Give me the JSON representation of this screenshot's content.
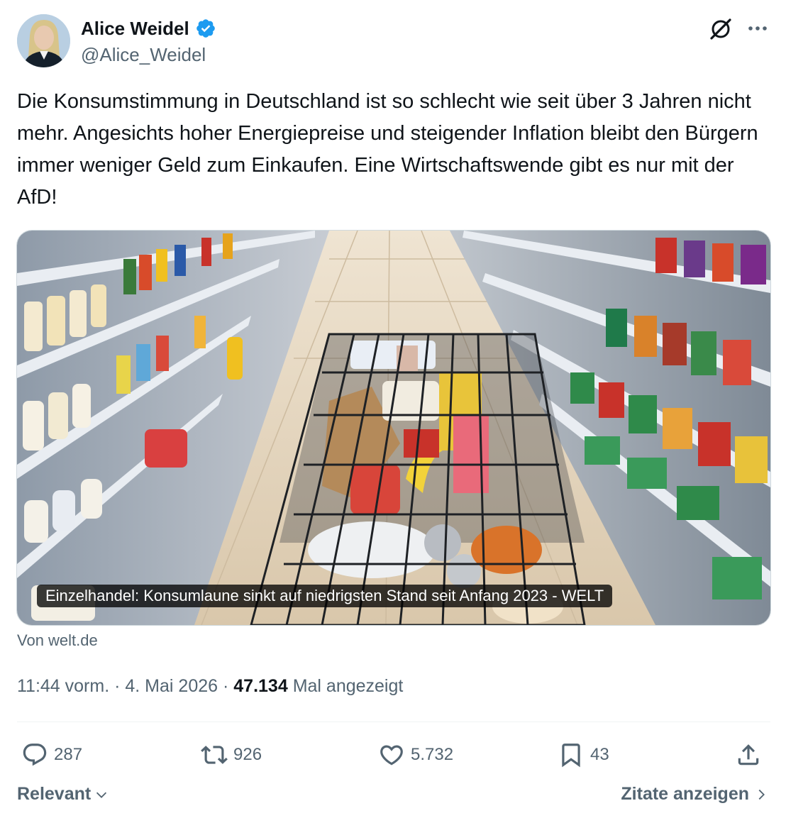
{
  "author": {
    "name": "Alice Weidel",
    "handle": "@Alice_Weidel",
    "verified": true,
    "verified_color": "#1d9bf0"
  },
  "tweet": {
    "text": "Die Konsumstimmung in Deutschland ist so schlecht wie seit über 3 Jahren nicht mehr. Angesichts hoher Energiepreise und steigender Inflation bleibt den Bürgern immer weniger Geld zum Einkaufen. Eine Wirtschaftswende gibt es nur mit der AfD!"
  },
  "card": {
    "caption": "Einzelhandel: Konsumlaune sinkt auf niedrigsten Stand seit Anfang 2023 - WELT",
    "source": "Von welt.de"
  },
  "meta": {
    "time": "11:44 vorm.",
    "separator": "·",
    "date": "4. Mai 2026",
    "views": "47.134",
    "views_label": "Mal angezeigt"
  },
  "actions": {
    "replies": "287",
    "reposts": "926",
    "likes": "5.732",
    "bookmarks": "43"
  },
  "footer": {
    "sort_label": "Relevant",
    "quotes_label": "Zitate anzeigen"
  },
  "icons": {
    "header": [
      "grok-icon",
      "more-icon"
    ],
    "actions": [
      "reply-icon",
      "repost-icon",
      "like-icon",
      "bookmark-icon",
      "share-icon"
    ]
  }
}
